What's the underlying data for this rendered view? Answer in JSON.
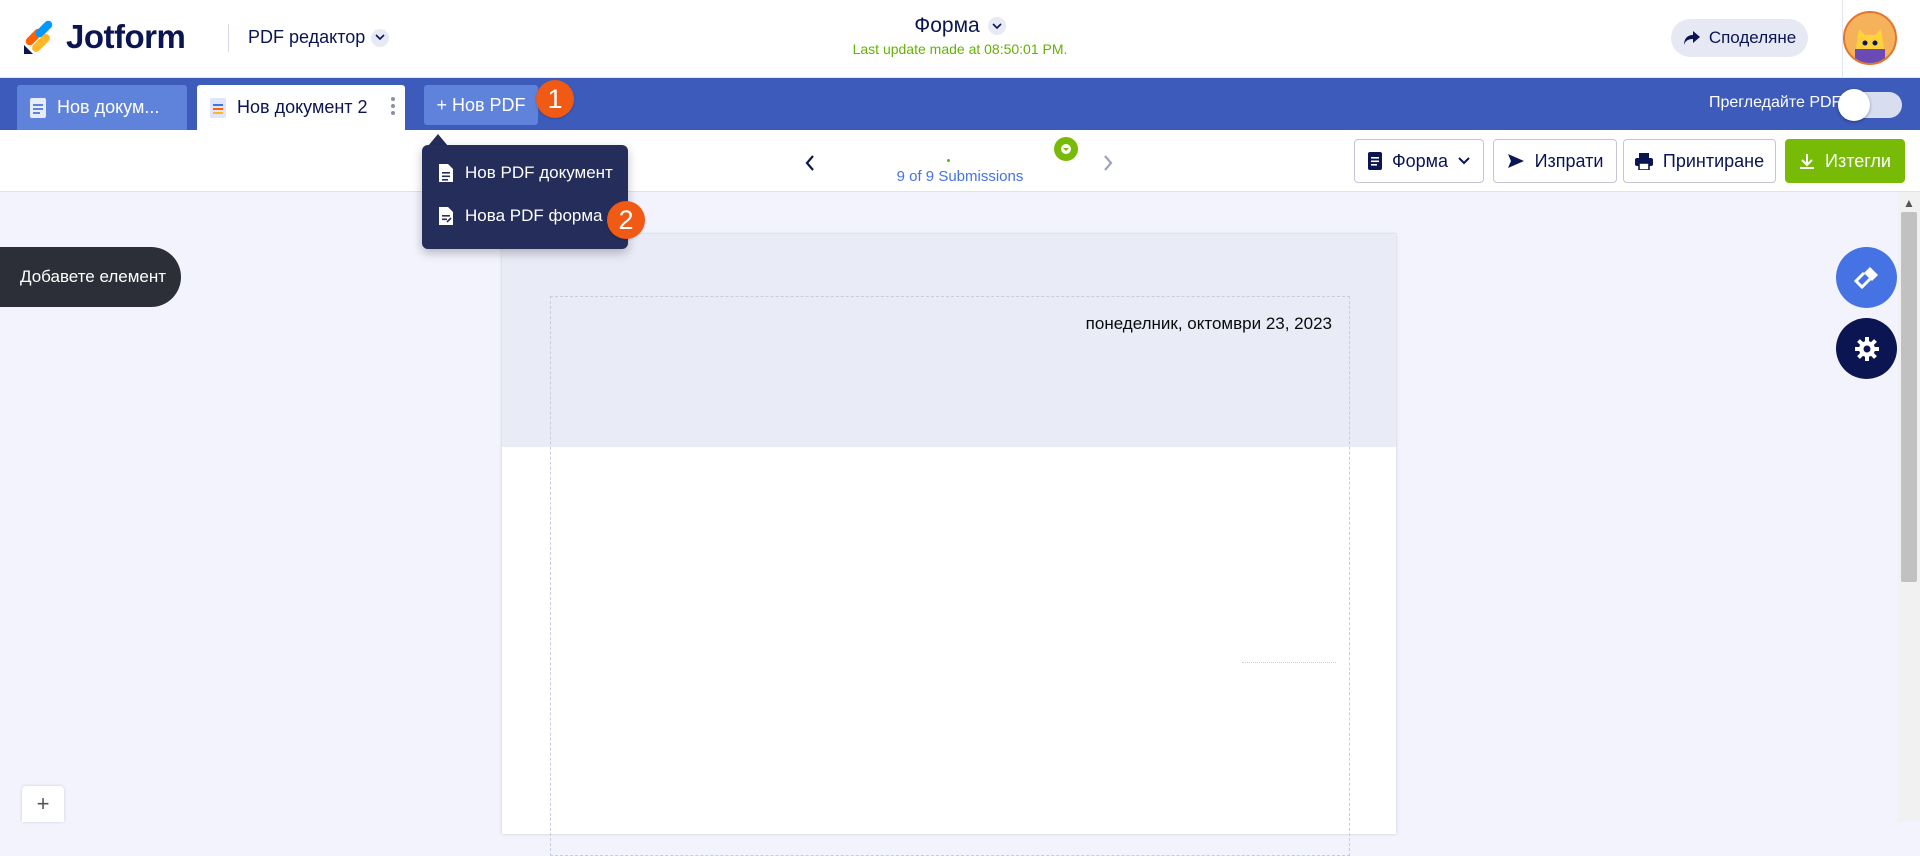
{
  "header": {
    "logo_text": "Jotform",
    "product_label": "PDF редактор",
    "doc_title": "Форма",
    "last_update": "Last update made at 08:50:01 PM.",
    "share_label": "Споделяне"
  },
  "tabs": [
    {
      "label": "Нов докум...",
      "active": false
    },
    {
      "label": "Нов документ 2",
      "active": true
    }
  ],
  "new_pdf": {
    "label": "+ Нов PDF",
    "badge": "1"
  },
  "preview": {
    "label": "Прегледайте PDF",
    "enabled": false
  },
  "toolbar": {
    "submission_count": "9 of 9 Submissions",
    "form_label": "Форма",
    "send_label": "Изпрати",
    "print_label": "Принтиране",
    "download_label": "Изтегли"
  },
  "dropdown": {
    "items": [
      {
        "label": "Нов PDF документ"
      },
      {
        "label": "Нова PDF форма",
        "badge": "2"
      }
    ]
  },
  "canvas": {
    "add_element_label": "Добавете елемент",
    "page_date": "понеделник, октомври 23, 2023",
    "zoom_in": "+"
  },
  "colors": {
    "brand_blue": "#3d5bbb",
    "accent_green": "#78bb07",
    "badge_orange": "#f05a14",
    "navy": "#0a1551"
  }
}
